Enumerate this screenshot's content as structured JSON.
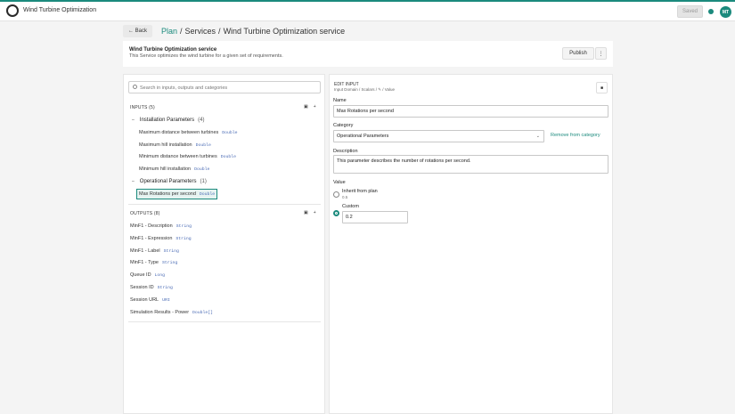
{
  "app": {
    "title": "Wind Turbine Optimization",
    "avatar_initials": "MT",
    "accent_color": "#1b8a7d"
  },
  "topbar": {
    "save_label": "Saved"
  },
  "nav": {
    "back_label": "← Back",
    "breadcrumb": [
      "Plan",
      "Services",
      "Wind Turbine Optimization service"
    ],
    "separator": "/"
  },
  "service": {
    "title": "Wind Turbine Optimization service",
    "description": "This Service optimizes the wind turbine for a given set of requirements.",
    "publish_label": "Publish",
    "more_label": "⋮"
  },
  "search": {
    "placeholder": "Search in inputs, outputs and categories"
  },
  "inputs": {
    "header": "INPUTS (5)",
    "groups": [
      {
        "name": "Installation Parameters",
        "count": "(4)",
        "items": [
          {
            "label": "Maximum distance between turbines",
            "type": "Double"
          },
          {
            "label": "Maximum hill installation",
            "type": "Double"
          },
          {
            "label": "Minimum distance between turbines",
            "type": "Double"
          },
          {
            "label": "Minimum hill installation",
            "type": "Double"
          }
        ]
      },
      {
        "name": "Operational Parameters",
        "count": "(1)",
        "items": [
          {
            "label": "Max Rotations per second",
            "type": "Double"
          }
        ]
      }
    ]
  },
  "outputs": {
    "header": "OUTPUTS (8)",
    "items": [
      {
        "label": "MinF1 - Description",
        "type": "String"
      },
      {
        "label": "MinF1 - Expression",
        "type": "String"
      },
      {
        "label": "MinF1 - Label",
        "type": "String"
      },
      {
        "label": "MinF1 - Type",
        "type": "String"
      },
      {
        "label": "Queue ID",
        "type": "Long"
      },
      {
        "label": "Session ID",
        "type": "String"
      },
      {
        "label": "Session URL",
        "type": "URI"
      },
      {
        "label": "Simulation Results - Power",
        "type": "Double[]"
      }
    ]
  },
  "edit": {
    "title": "EDIT INPUT",
    "path": "Input Domain / Scalars / ✎ / Value",
    "name_label": "Name",
    "name_value": "Max Rotations per second",
    "category_label": "Category",
    "category_value": "Operational Parameters",
    "remove_label": "Remove from category",
    "description_label": "Description",
    "description_value": "This parameter describes the number of rotations per second.",
    "value_label": "Value",
    "inherit_label": "Inherit from plan",
    "inherit_value": "0.5",
    "custom_label": "Custom",
    "custom_value": "0.2"
  }
}
